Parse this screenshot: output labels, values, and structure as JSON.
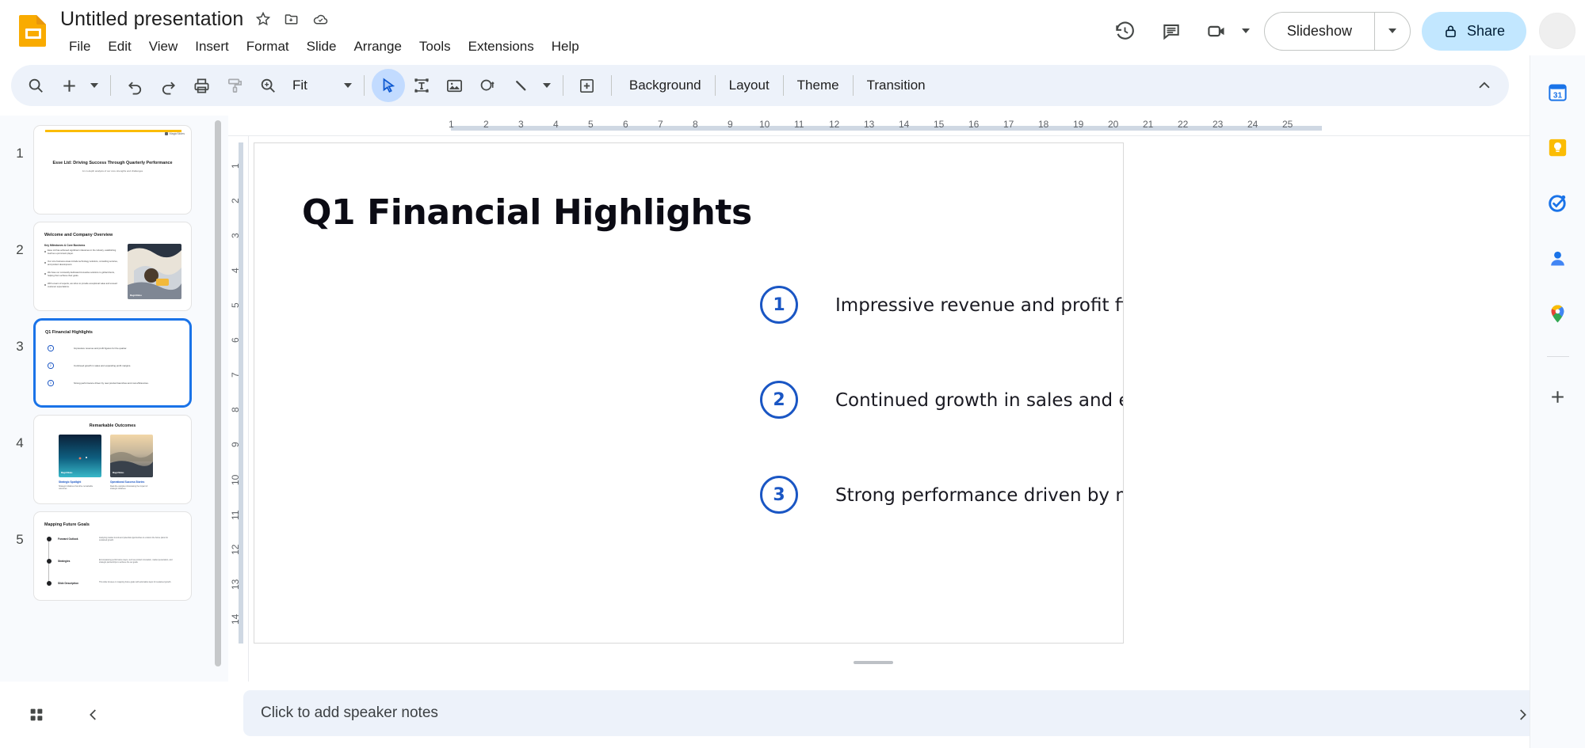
{
  "app": {
    "doc_title": "Untitled presentation",
    "logo_name": "google-slides-logo"
  },
  "title_actions": [
    {
      "name": "star-icon",
      "label": "Star"
    },
    {
      "name": "move-to-folder-icon",
      "label": "Move"
    },
    {
      "name": "cloud-saved-icon",
      "label": "Saved to Drive"
    }
  ],
  "menubar": {
    "items": [
      {
        "label": "File"
      },
      {
        "label": "Edit"
      },
      {
        "label": "View"
      },
      {
        "label": "Insert"
      },
      {
        "label": "Format"
      },
      {
        "label": "Slide"
      },
      {
        "label": "Arrange"
      },
      {
        "label": "Tools"
      },
      {
        "label": "Extensions"
      },
      {
        "label": "Help"
      }
    ]
  },
  "top_right": {
    "history_icon": "version-history-icon",
    "comments_icon": "comments-icon",
    "meet_icon": "meet-camera-icon",
    "slideshow_label": "Slideshow",
    "share_label": "Share",
    "share_lock_icon": "lock-icon",
    "avatar_name": "user-avatar"
  },
  "toolbar": {
    "search_icon": "search-icon",
    "new_slide_icon": "add-slide-icon",
    "undo_icon": "undo-icon",
    "redo_icon": "redo-icon",
    "print_icon": "print-icon",
    "paint_format_icon": "paint-format-icon",
    "zoom_icon": "zoom-icon",
    "zoom_level": "Fit",
    "select_icon": "select-cursor-icon",
    "textbox_icon": "text-box-icon",
    "image_icon": "insert-image-icon",
    "shape_icon": "shape-icon",
    "line_icon": "line-icon",
    "transition_icon": "add-comment-icon",
    "background_label": "Background",
    "layout_label": "Layout",
    "theme_label": "Theme",
    "transition_label": "Transition",
    "collapse_icon": "collapse-toolbar-icon"
  },
  "filmstrip": {
    "slides": [
      {
        "number": "1",
        "layout": "title",
        "brand": "MagicSlides",
        "title": "Esse Ltd: Driving Success Through Quarterly Performance",
        "subtitle": "An in-depth analysis of our core strengths and challenges",
        "selected": false
      },
      {
        "number": "2",
        "layout": "bullets-image",
        "title": "Welcome and Company Overview",
        "subtitle": "Key Milestones & Core Business",
        "bullets": [
          "Esse Ltd has achieved significant milestones in the industry, establishing itself as a prominent player.",
          "Our core business areas include technology solutions, consulting services, and product development.",
          "We have our constantly dedicated innovative solutions to global clients, helping them achieve their goals.",
          "With a team of experts, we strive to provide exceptional value and exceed customer expectations."
        ],
        "image_caption": "MagicSlides",
        "selected": false
      },
      {
        "number": "3",
        "layout": "numbered",
        "title": "Q1 Financial Highlights",
        "items": [
          "Impressive revenue and profit figures for the quarter.",
          "Continued growth in sales and expanding profit margins.",
          "Strong performance driven by new product launches and cost efficiencies."
        ],
        "selected": true
      },
      {
        "number": "4",
        "layout": "two-image",
        "title": "Remarkable Outcomes",
        "cards": [
          {
            "title": "Strategic Spotlight",
            "body": "Strategic initiatives that drive remarkable outcomes.",
            "badge": "MagicSlides"
          },
          {
            "title": "Operational Success Stories",
            "body": "Real-life examples showcasing the impact of strategic initiatives.",
            "badge": "MagicSlides"
          }
        ],
        "selected": false
      },
      {
        "number": "5",
        "layout": "timeline",
        "title": "Mapping Future Goals",
        "rows": [
          {
            "label": "Forward Outlook",
            "body": "Analyzing market trends and potential opportunities to envision the future plans for sustained growth."
          },
          {
            "label": "Strategies",
            "body": "Encompassing performance steps, such as product innovation, market penetration, and strategic partnerships to achieve the set goals."
          },
          {
            "label": "Slide Description",
            "body": "This slide focuses on mapping future goals with actionable steps for sustained growth."
          }
        ],
        "selected": false
      }
    ]
  },
  "ruler": {
    "h_ticks": [
      "1",
      "2",
      "3",
      "4",
      "5",
      "6",
      "7",
      "8",
      "9",
      "10",
      "11",
      "12",
      "13",
      "14",
      "15",
      "16",
      "17",
      "18",
      "19",
      "20",
      "21",
      "22",
      "23",
      "24",
      "25"
    ],
    "v_ticks": [
      "1",
      "2",
      "3",
      "4",
      "5",
      "6",
      "7",
      "8",
      "9",
      "10",
      "11",
      "12",
      "13",
      "14"
    ]
  },
  "slide": {
    "title": "Q1 Financial Highlights",
    "items": [
      {
        "number": "1",
        "text": "Impressive revenue and profit figures for the quarter."
      },
      {
        "number": "2",
        "text": "Continued growth in sales and expanding profit margins."
      },
      {
        "number": "3",
        "text": "Strong performance driven by new product launches and cost efficiencies."
      }
    ],
    "accent_color": "#1a56c4",
    "title_color": "#0b0b14"
  },
  "notes": {
    "grid_icon": "grid-view-icon",
    "collapse_icon": "collapse-filmstrip-icon",
    "placeholder": "Click to add speaker notes",
    "expand_icon": "expand-panel-icon"
  },
  "side_panel": {
    "items": [
      {
        "name": "google-calendar-icon",
        "label": "Calendar"
      },
      {
        "name": "google-keep-icon",
        "label": "Keep"
      },
      {
        "name": "google-tasks-icon",
        "label": "Tasks"
      },
      {
        "name": "google-contacts-icon",
        "label": "Contacts"
      },
      {
        "name": "google-maps-icon",
        "label": "Maps"
      }
    ],
    "add_label": "Get Add-ons"
  }
}
